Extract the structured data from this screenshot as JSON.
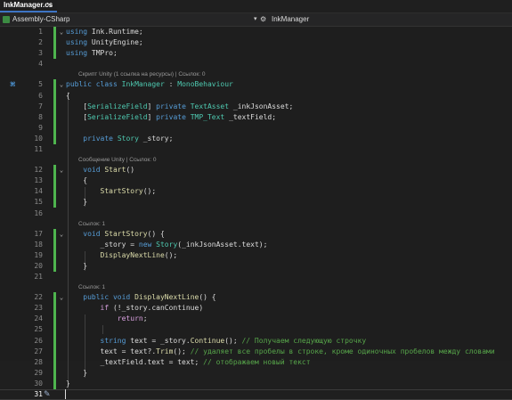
{
  "tab": {
    "label": "InkManager.cs",
    "close_glyph": "✕"
  },
  "nav": {
    "project": "Assembly-CSharp",
    "member": "InkManager"
  },
  "code_lines": [
    {
      "n": "1",
      "tokens": [
        [
          "kw",
          "using"
        ],
        [
          "tx",
          " Ink.Runtime;"
        ]
      ]
    },
    {
      "n": "2",
      "tokens": [
        [
          "kw",
          "using"
        ],
        [
          "tx",
          " UnityEngine;"
        ]
      ]
    },
    {
      "n": "3",
      "tokens": [
        [
          "kw",
          "using"
        ],
        [
          "tx",
          " TMPro;"
        ]
      ]
    },
    {
      "n": "4",
      "tokens": []
    },
    {
      "n": "5",
      "tokens": [
        [
          "kw",
          "public class"
        ],
        [
          "tx",
          " "
        ],
        [
          "ty",
          "InkManager"
        ],
        [
          "tx",
          " : "
        ],
        [
          "ty",
          "MonoBehaviour"
        ]
      ]
    },
    {
      "n": "6",
      "tokens": [
        [
          "tx",
          "{"
        ]
      ]
    },
    {
      "n": "7",
      "tokens": [
        [
          "tx",
          "    ["
        ],
        [
          "ty",
          "SerializeField"
        ],
        [
          "tx",
          "] "
        ],
        [
          "kw",
          "private"
        ],
        [
          "tx",
          " "
        ],
        [
          "ty",
          "TextAsset"
        ],
        [
          "tx",
          " _inkJsonAsset;"
        ]
      ]
    },
    {
      "n": "8",
      "tokens": [
        [
          "tx",
          "    ["
        ],
        [
          "ty",
          "SerializeField"
        ],
        [
          "tx",
          "] "
        ],
        [
          "kw",
          "private"
        ],
        [
          "tx",
          " "
        ],
        [
          "ty",
          "TMP_Text"
        ],
        [
          "tx",
          " _textField;"
        ]
      ]
    },
    {
      "n": "9",
      "tokens": []
    },
    {
      "n": "10",
      "tokens": [
        [
          "tx",
          "    "
        ],
        [
          "kw",
          "private"
        ],
        [
          "tx",
          " "
        ],
        [
          "ty",
          "Story"
        ],
        [
          "tx",
          " _story;"
        ]
      ]
    },
    {
      "n": "11",
      "tokens": []
    },
    {
      "n": "12",
      "tokens": [
        [
          "tx",
          "    "
        ],
        [
          "kw",
          "void"
        ],
        [
          "tx",
          " "
        ],
        [
          "fn",
          "Start"
        ],
        [
          "tx",
          "()"
        ]
      ]
    },
    {
      "n": "13",
      "tokens": [
        [
          "tx",
          "    {"
        ]
      ]
    },
    {
      "n": "14",
      "tokens": [
        [
          "tx",
          "        "
        ],
        [
          "fn",
          "StartStory"
        ],
        [
          "tx",
          "();"
        ]
      ]
    },
    {
      "n": "15",
      "tokens": [
        [
          "tx",
          "    }"
        ]
      ]
    },
    {
      "n": "16",
      "tokens": []
    },
    {
      "n": "17",
      "tokens": [
        [
          "tx",
          "    "
        ],
        [
          "kw",
          "void"
        ],
        [
          "tx",
          " "
        ],
        [
          "fn",
          "StartStory"
        ],
        [
          "tx",
          "() {"
        ]
      ]
    },
    {
      "n": "18",
      "tokens": [
        [
          "tx",
          "        _story = "
        ],
        [
          "kw",
          "new"
        ],
        [
          "tx",
          " "
        ],
        [
          "ty",
          "Story"
        ],
        [
          "tx",
          "(_inkJsonAsset.text);"
        ]
      ]
    },
    {
      "n": "19",
      "tokens": [
        [
          "tx",
          "        "
        ],
        [
          "fn",
          "DisplayNextLine"
        ],
        [
          "tx",
          "();"
        ]
      ]
    },
    {
      "n": "20",
      "tokens": [
        [
          "tx",
          "    }"
        ]
      ]
    },
    {
      "n": "21",
      "tokens": []
    },
    {
      "n": "22",
      "tokens": [
        [
          "tx",
          "    "
        ],
        [
          "kw",
          "public void"
        ],
        [
          "tx",
          " "
        ],
        [
          "fn",
          "DisplayNextLine"
        ],
        [
          "tx",
          "() {"
        ]
      ]
    },
    {
      "n": "23",
      "tokens": [
        [
          "tx",
          "        "
        ],
        [
          "ct",
          "if"
        ],
        [
          "tx",
          " (!_story.canContinue)"
        ]
      ]
    },
    {
      "n": "24",
      "tokens": [
        [
          "tx",
          "            "
        ],
        [
          "ct",
          "return"
        ],
        [
          "tx",
          ";"
        ]
      ]
    },
    {
      "n": "25",
      "tokens": []
    },
    {
      "n": "26",
      "tokens": [
        [
          "tx",
          "        "
        ],
        [
          "kw",
          "string"
        ],
        [
          "tx",
          " text = _story."
        ],
        [
          "fn",
          "Continue"
        ],
        [
          "tx",
          "(); "
        ],
        [
          "cm",
          "// Получаем следующую строчку"
        ]
      ]
    },
    {
      "n": "27",
      "tokens": [
        [
          "tx",
          "        text = text?."
        ],
        [
          "fn",
          "Trim"
        ],
        [
          "tx",
          "(); "
        ],
        [
          "cm",
          "// удаляет все пробелы в строке, кроме одиночных пробелов между словами"
        ]
      ]
    },
    {
      "n": "28",
      "tokens": [
        [
          "tx",
          "        _textField.text = text; "
        ],
        [
          "cm",
          "// отображаем новый текст"
        ]
      ]
    },
    {
      "n": "29",
      "tokens": [
        [
          "tx",
          "    }"
        ]
      ]
    },
    {
      "n": "30",
      "tokens": [
        [
          "tx",
          "}"
        ]
      ]
    },
    {
      "n": "31",
      "tokens": []
    }
  ],
  "codelens": {
    "class": "Скрипт Unity (1 ссылка на ресурсы) | Ссылок: 0",
    "start": "Сообщение Unity | Ссылок: 0",
    "startstory": "Ссылок: 1",
    "displaynext": "Ссылок: 1"
  },
  "icons": {
    "fold": "chevron-icon",
    "class_marker": "unity-script-icon",
    "edit": "pencil-icon",
    "nav_project": "csharp-project-icon",
    "nav_member": "class-icon"
  }
}
